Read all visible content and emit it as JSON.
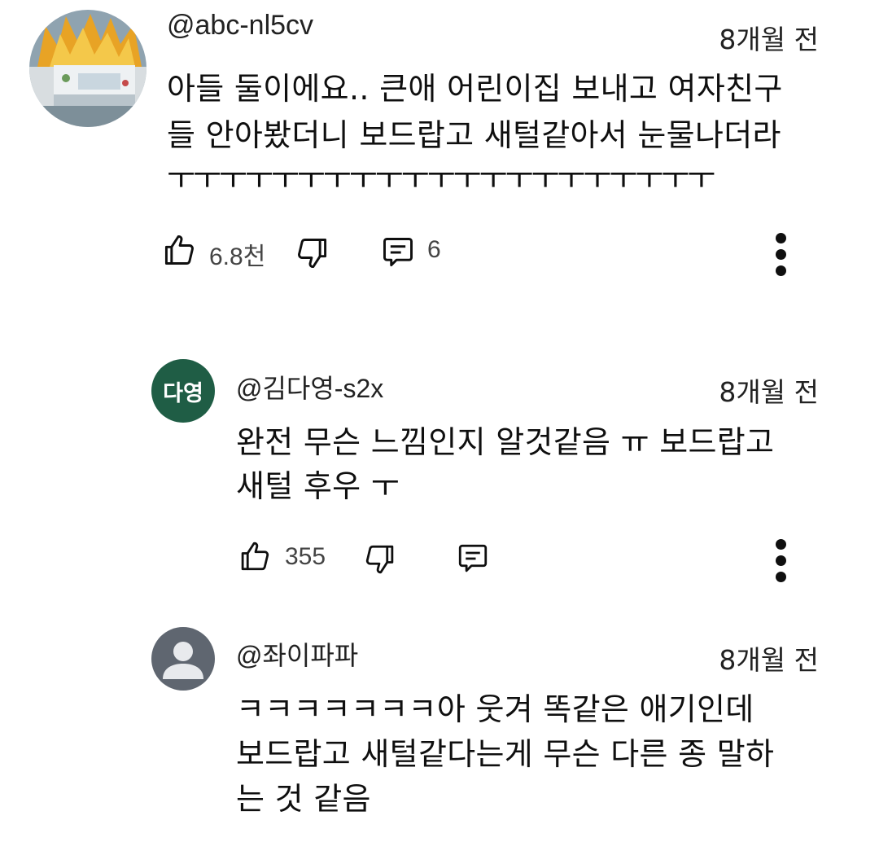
{
  "comments": [
    {
      "handle": "@abc-nl5cv",
      "time": "8개월 전",
      "lines": [
        "아들 둘이에요.. 큰애 어린이집 보내고 여자친구",
        "들 안아봤더니 보드랍고 새털같아서 눈물나더라",
        "ㅜㅜㅜㅜㅜㅜㅜㅜㅜㅜㅜㅜㅜㅜㅜㅜㅜㅜㅜㅜㅜ"
      ],
      "likes": "6.8천",
      "replies": "6",
      "avatar": {
        "kind": "image",
        "desc": "birthday-cake-photo"
      }
    },
    {
      "handle": "@김다영-s2x",
      "time": "8개월 전",
      "lines": [
        "완전 무슨 느낌인지 알것같음 ㅠ 보드랍고",
        "새털 후우 ㅜ"
      ],
      "likes": "355",
      "replies": "",
      "avatar": {
        "kind": "initials",
        "text": "다영",
        "color": "#1f5d45"
      }
    },
    {
      "handle": "@좌이파파",
      "time": "8개월 전",
      "lines": [
        "ㅋㅋㅋㅋㅋㅋㅋ아 웃겨 똑같은 애기인데",
        "보드랍고 새털같다는게 무슨 다른 종 말하",
        "는 것 같음"
      ],
      "likes": "",
      "replies": "",
      "avatar": {
        "kind": "default",
        "color": "#5f6670"
      }
    }
  ],
  "icons": {
    "like": "thumbs-up-icon",
    "dislike": "thumbs-down-icon",
    "reply": "reply-comment-icon",
    "more": "more-vert-icon"
  }
}
